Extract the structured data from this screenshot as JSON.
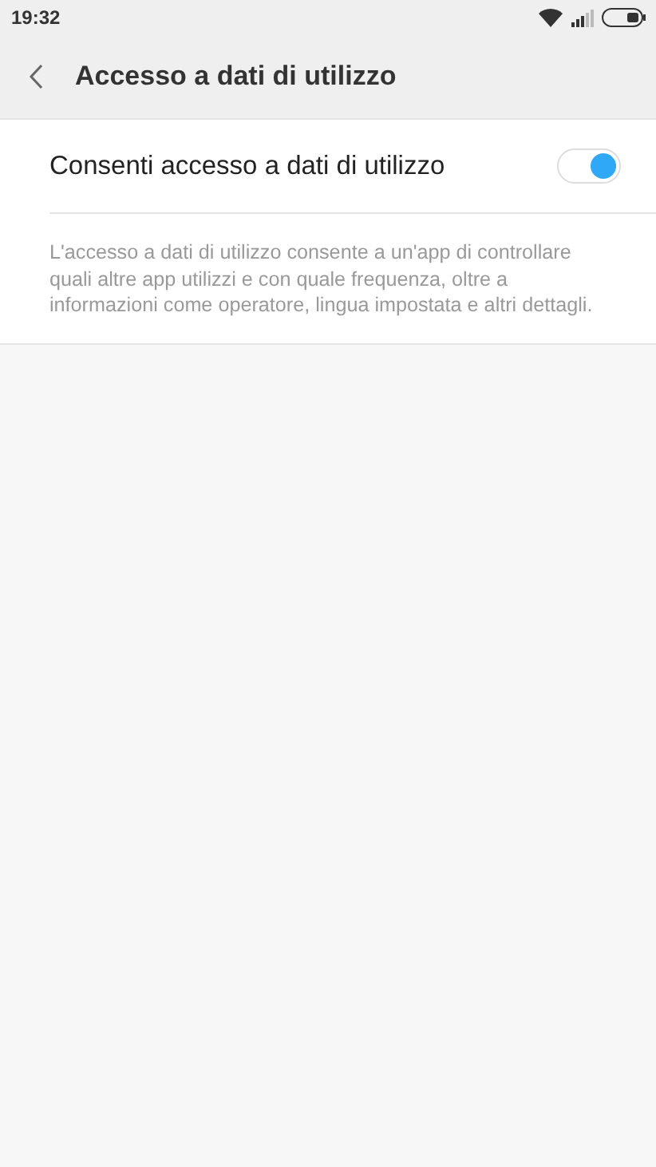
{
  "status_bar": {
    "time": "19:32"
  },
  "header": {
    "title": "Accesso a dati di utilizzo"
  },
  "setting": {
    "label": "Consenti accesso a dati di utilizzo",
    "on": true
  },
  "description": "L'accesso a dati di utilizzo consente a un'app di controllare quali altre app utilizzi e con quale frequenza, oltre a informazioni come operatore, lingua impostata e altri dettagli."
}
